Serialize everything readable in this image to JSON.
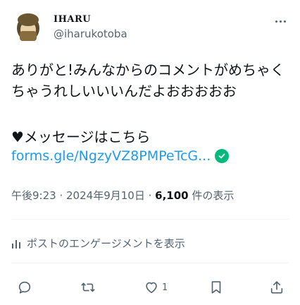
{
  "author": {
    "display_name": "IHARU",
    "handle": "@iharukotoba"
  },
  "tweet": {
    "text": "ありがと!みんなからのコメントがめちゃくちゃうれしいいいんだよおおおおお",
    "message_line": "♥メッセージはこちら",
    "link": "forms.gle/NgzyVZ8PMPeTcG..."
  },
  "meta": {
    "time": "午後9:23",
    "date": "2024年9月10日",
    "views_count": "6,100",
    "views_label": "件の表示"
  },
  "engagements": {
    "label": "ポストのエンゲージメントを表示"
  },
  "actions": {
    "likes_count": "1"
  },
  "icons": {
    "reply": "reply-icon",
    "repost": "repost-icon",
    "like": "like-icon",
    "bookmark": "bookmark-icon",
    "share": "share-icon"
  }
}
